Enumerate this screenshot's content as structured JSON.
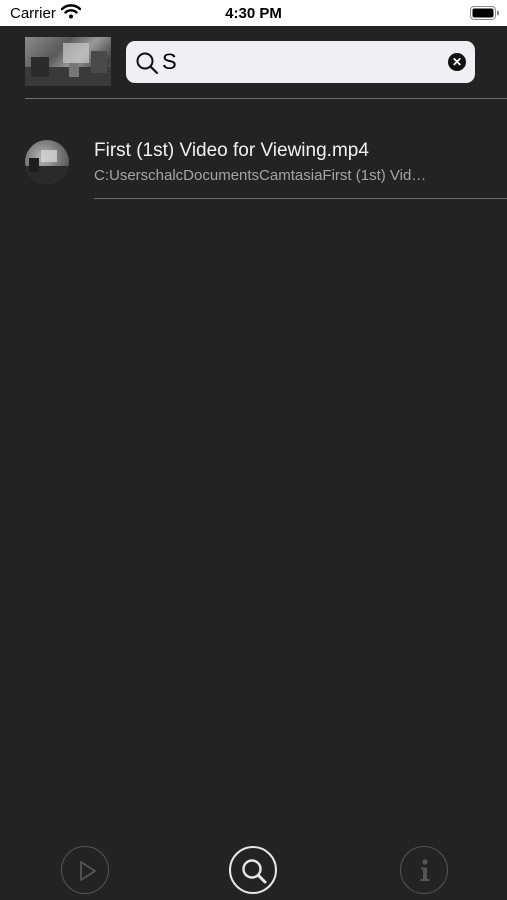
{
  "status_bar": {
    "carrier": "Carrier",
    "time": "4:30 PM"
  },
  "search": {
    "value": "S",
    "placeholder": ""
  },
  "results": [
    {
      "title": "First (1st) Video for Viewing.mp4",
      "path": "C:UserschalcDocumentsCamtasiaFirst (1st) Vid…"
    }
  ],
  "tab_bar": {
    "icons": [
      "play-icon",
      "search-icon",
      "info-icon"
    ],
    "selected": "search"
  },
  "colors": {
    "background": "#232323",
    "search_field": "#eef0f4",
    "caret": "#2a6cf6",
    "divider": "#6e6e6e",
    "active_tab": "#e6e6e6",
    "inactive_tab": "#555555"
  }
}
